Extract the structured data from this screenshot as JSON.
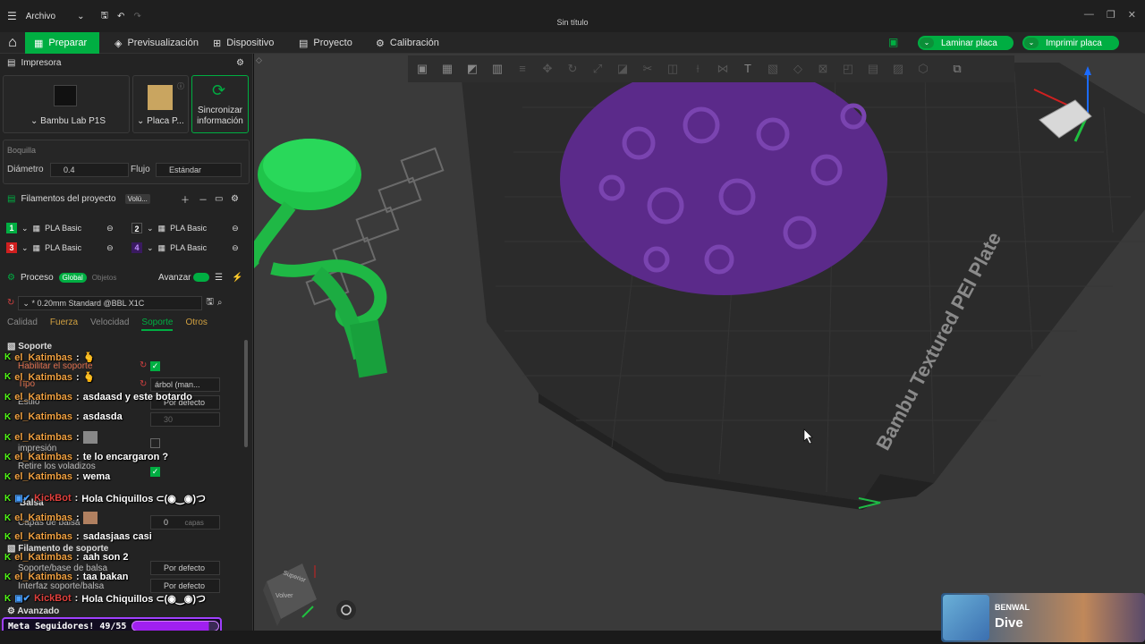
{
  "titlebar": {
    "menu_label": "Archivo",
    "title": "Sin título"
  },
  "tabs": {
    "prepare": "Preparar",
    "preview": "Previsualización",
    "device": "Dispositivo",
    "project": "Proyecto",
    "calibration": "Calibración"
  },
  "actions": {
    "slice": "Laminar placa",
    "print": "Imprimir placa"
  },
  "printer": {
    "section": "Impresora",
    "name": "Bambu Lab P1S",
    "plate": "Placa P...",
    "sync_l1": "Sincronizar",
    "sync_l2": "información"
  },
  "nozzle": {
    "section": "Boquilla",
    "diameter_label": "Diámetro",
    "diameter_value": "0.4",
    "flow_label": "Flujo",
    "flow_value": "Estándar"
  },
  "filaments": {
    "section": "Filamentos del proyecto",
    "vol_label": "Volú...",
    "items": [
      {
        "num": "1",
        "name": "PLA Basic",
        "color": "#00ae42"
      },
      {
        "num": "2",
        "name": "PLA Basic",
        "color": "#222222"
      },
      {
        "num": "3",
        "name": "PLA Basic",
        "color": "#d01f1f"
      },
      {
        "num": "4",
        "name": "PLA Basic",
        "color": "#6a2fa0"
      }
    ]
  },
  "process": {
    "section": "Proceso",
    "global_label": "Global",
    "objects_label": "Objetos",
    "advanced_label": "Avanzar",
    "preset": "* 0.20mm Standard @BBL X1C",
    "subtabs": [
      "Calidad",
      "Fuerza",
      "Velocidad",
      "Soporte",
      "Otros"
    ],
    "active_subtab": "Soporte"
  },
  "support": {
    "group": "Soporte",
    "enable_label": "Habilitar el soporte",
    "type_label": "Tipo",
    "type_value": "árbol (man...",
    "style_label": "Estilo",
    "style_value": "Por defecto",
    "threshold_value": "30",
    "print_label": "impresión",
    "remove_label": "Retire los voladizos",
    "raft_group": "Balsa",
    "raft_layers_label": "Capas de balsa",
    "raft_layers_value": "0",
    "raft_layers_unit": "capas",
    "filament_group": "Filamento de soporte",
    "base_label": "Soporte/base de balsa",
    "base_value": "Por defecto",
    "interface_label": "Interfaz soporte/balsa",
    "interface_value": "Por defecto",
    "advanced_group": "Avanzado"
  },
  "chat": [
    {
      "user": "el_Katimbas",
      "msg": ""
    },
    {
      "user": "el_Katimbas",
      "msg": ""
    },
    {
      "user": "el_Katimbas",
      "msg": "asdaasd y este botardo"
    },
    {
      "user": "el_Katimbas",
      "msg": "asdasda"
    },
    {
      "user": "el_Katimbas",
      "msg": ""
    },
    {
      "user": "el_Katimbas",
      "msg": "te lo encargaron ?"
    },
    {
      "user": "el_Katimbas",
      "msg": "wema"
    },
    {
      "user": "KickBot",
      "msg": "Hola Chiquillos ⊂(◉‿◉)つ"
    },
    {
      "user": "el_Katimbas",
      "msg": ""
    },
    {
      "user": "el_Katimbas",
      "msg": "sadasjaas casi"
    },
    {
      "user": "el_Katimbas",
      "msg": "aah son 2"
    },
    {
      "user": "el_Katimbas",
      "msg": "taa bakan"
    },
    {
      "user": "KickBot",
      "msg": "Hola Chiquillos ⊂(◉‿◉)つ"
    }
  ],
  "meta": {
    "label": "Meta Seguidores! 49/55",
    "progress": 0.89
  },
  "plate": {
    "label": "Bambu Textured PEI Plate"
  },
  "navcube": {
    "top": "Superior",
    "front": "Volver"
  },
  "music": {
    "artist": "BENWAL",
    "song": "Dive"
  }
}
